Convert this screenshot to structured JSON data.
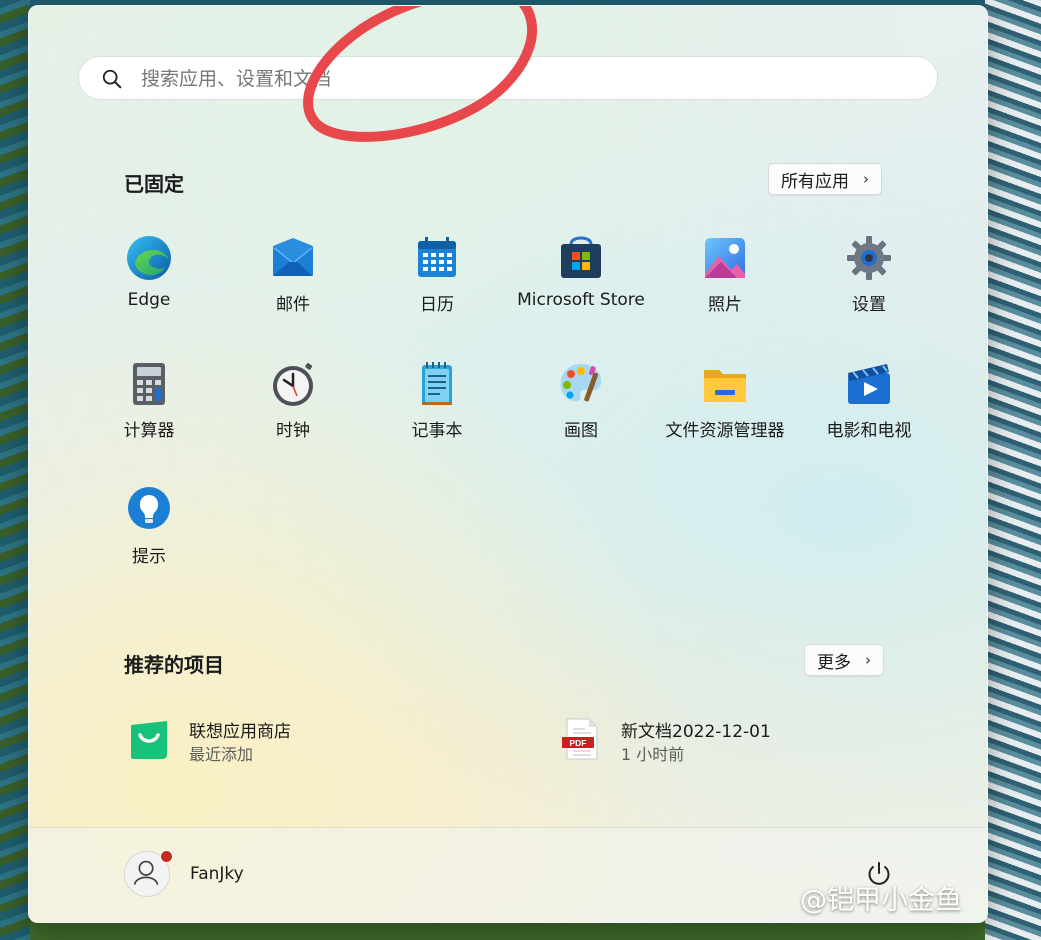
{
  "search": {
    "placeholder": "搜索应用、设置和文档"
  },
  "pinned": {
    "title": "已固定",
    "all_apps_label": "所有应用",
    "apps": [
      {
        "label": "Edge",
        "icon": "edge-icon"
      },
      {
        "label": "邮件",
        "icon": "mail-icon"
      },
      {
        "label": "日历",
        "icon": "calendar-icon"
      },
      {
        "label": "Microsoft Store",
        "icon": "store-icon"
      },
      {
        "label": "照片",
        "icon": "photos-icon"
      },
      {
        "label": "设置",
        "icon": "settings-gear-icon"
      },
      {
        "label": "计算器",
        "icon": "calculator-icon"
      },
      {
        "label": "时钟",
        "icon": "clock-icon"
      },
      {
        "label": "记事本",
        "icon": "notepad-icon"
      },
      {
        "label": "画图",
        "icon": "paint-palette-icon"
      },
      {
        "label": "文件资源管理器",
        "icon": "folder-icon"
      },
      {
        "label": "电影和电视",
        "icon": "movies-tv-icon"
      },
      {
        "label": "提示",
        "icon": "tips-lightbulb-icon"
      }
    ]
  },
  "recommended": {
    "title": "推荐的项目",
    "more_label": "更多",
    "items": [
      {
        "name": "联想应用商店",
        "sub": "最近添加",
        "icon": "lenovo-app-store-icon"
      },
      {
        "name": "新文档2022-12-01",
        "sub": "1 小时前",
        "icon": "pdf-file-icon"
      }
    ]
  },
  "user": {
    "name": "FanJky"
  },
  "watermark": "@铠甲小金鱼",
  "colors": {
    "annotation_red": "#e8484b",
    "accent_blue": "#0a64c8"
  }
}
